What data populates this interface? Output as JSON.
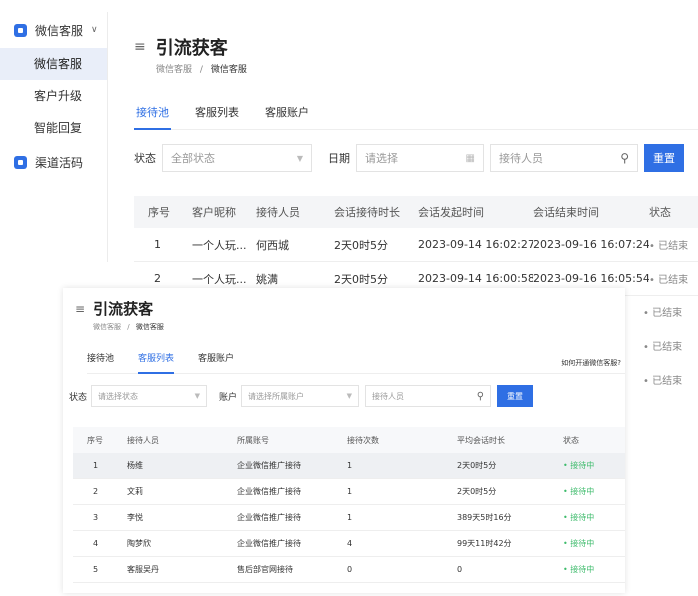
{
  "sidebar": {
    "group_label": "微信客服",
    "items": [
      {
        "label": "微信客服",
        "active": true
      },
      {
        "label": "客户升级",
        "active": false
      },
      {
        "label": "智能回复",
        "active": false
      }
    ],
    "group2_label": "渠道活码"
  },
  "back": {
    "title": "引流获客",
    "breadcrumb": [
      "微信客服",
      "/",
      "微信客服"
    ],
    "tabs": [
      "接待池",
      "客服列表",
      "客服账户"
    ],
    "filters": {
      "status_label": "状态",
      "status_value": "全部状态",
      "date_label": "日期",
      "date_placeholder": "请选择",
      "agent_placeholder": "接待人员",
      "reset": "重置"
    },
    "columns": [
      "序号",
      "客户昵称",
      "接待人员",
      "会话接待时长",
      "会话发起时间",
      "会话结束时间",
      "状态"
    ],
    "rows": [
      [
        "1",
        "一个人玩...",
        "何西城",
        "2天0时5分",
        "2023-09-14 16:02:27",
        "2023-09-16 16:07:24",
        "已结束"
      ],
      [
        "2",
        "一个人玩...",
        "姚满",
        "2天0时5分",
        "2023-09-14 16:00:58",
        "2023-09-16 16:05:54",
        "已结束"
      ]
    ],
    "extra_status": [
      "已结束",
      "已结束",
      "已结束"
    ]
  },
  "front": {
    "title": "引流获客",
    "breadcrumb": [
      "微信客服",
      "/",
      "微信客服"
    ],
    "tabs": [
      "接待池",
      "客服列表",
      "客服账户"
    ],
    "help": "如何开通微信客服?",
    "filters": {
      "status_label": "状态",
      "status_placeholder": "请选择状态",
      "account_label": "账户",
      "account_placeholder": "请选择所属账户",
      "agent_placeholder": "接待人员",
      "search": "重置"
    },
    "columns": [
      "序号",
      "接待人员",
      "所属账号",
      "接待次数",
      "平均会话时长",
      "状态"
    ],
    "rows": [
      [
        "1",
        "杨维",
        "企业微信推广接待",
        "1",
        "2天0时5分",
        "接待中"
      ],
      [
        "2",
        "文莉",
        "企业微信推广接待",
        "1",
        "2天0时5分",
        "接待中"
      ],
      [
        "3",
        "李悦",
        "企业微信推广接待",
        "1",
        "389天5时16分",
        "接待中"
      ],
      [
        "4",
        "陶梦欣",
        "企业微信推广接待",
        "4",
        "99天11时42分",
        "接待中"
      ],
      [
        "5",
        "客服吴丹",
        "售后部官网接待",
        "0",
        "0",
        "接待中"
      ]
    ]
  },
  "colors": {
    "accent": "#2f6fe4",
    "status_green": "#3dbb6b"
  }
}
